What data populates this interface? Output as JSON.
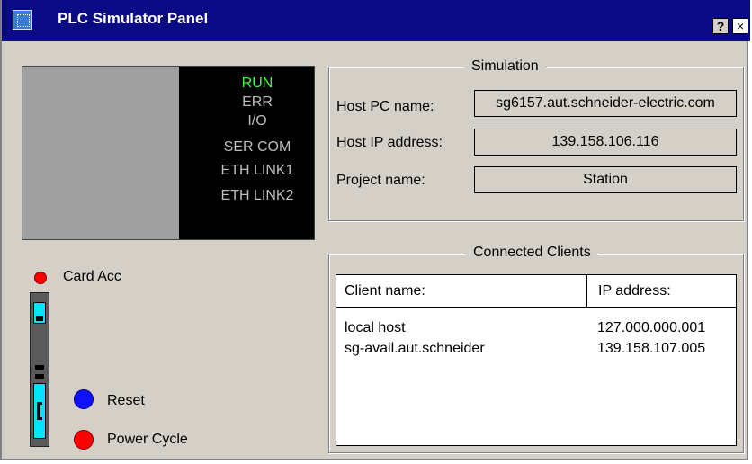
{
  "window": {
    "title": "PLC Simulator Panel",
    "help_label": "?",
    "close_label": "×"
  },
  "leds": [
    "RUN",
    "ERR",
    "I/O",
    "SER COM",
    "ETH LINK1",
    "ETH LINK2"
  ],
  "led_active": "RUN",
  "card": {
    "label": "Card Acc"
  },
  "controls": {
    "reset_label": "Reset",
    "power_cycle_label": "Power Cycle"
  },
  "simulation": {
    "title": "Simulation",
    "host_pc_label": "Host PC name:",
    "host_pc_value": "sg6157.aut.schneider-electric.com",
    "host_ip_label": "Host IP address:",
    "host_ip_value": "139.158.106.116",
    "project_label": "Project name:",
    "project_value": "Station"
  },
  "clients": {
    "title": "Connected Clients",
    "columns": [
      "Client name:",
      "IP address:"
    ],
    "rows": [
      {
        "name": "local host",
        "ip": "127.000.000.001"
      },
      {
        "name": "sg-avail.aut.schneider",
        "ip": "139.158.107.005"
      }
    ]
  },
  "colors": {
    "titlebar": "#0a0a84",
    "led_on": "#3cff3c",
    "led_off": "#bdbdbd",
    "card_indicator": "#ff0000",
    "reset": "#1010ff",
    "power_cycle": "#ff0000",
    "module_accent": "#00e5ff"
  }
}
